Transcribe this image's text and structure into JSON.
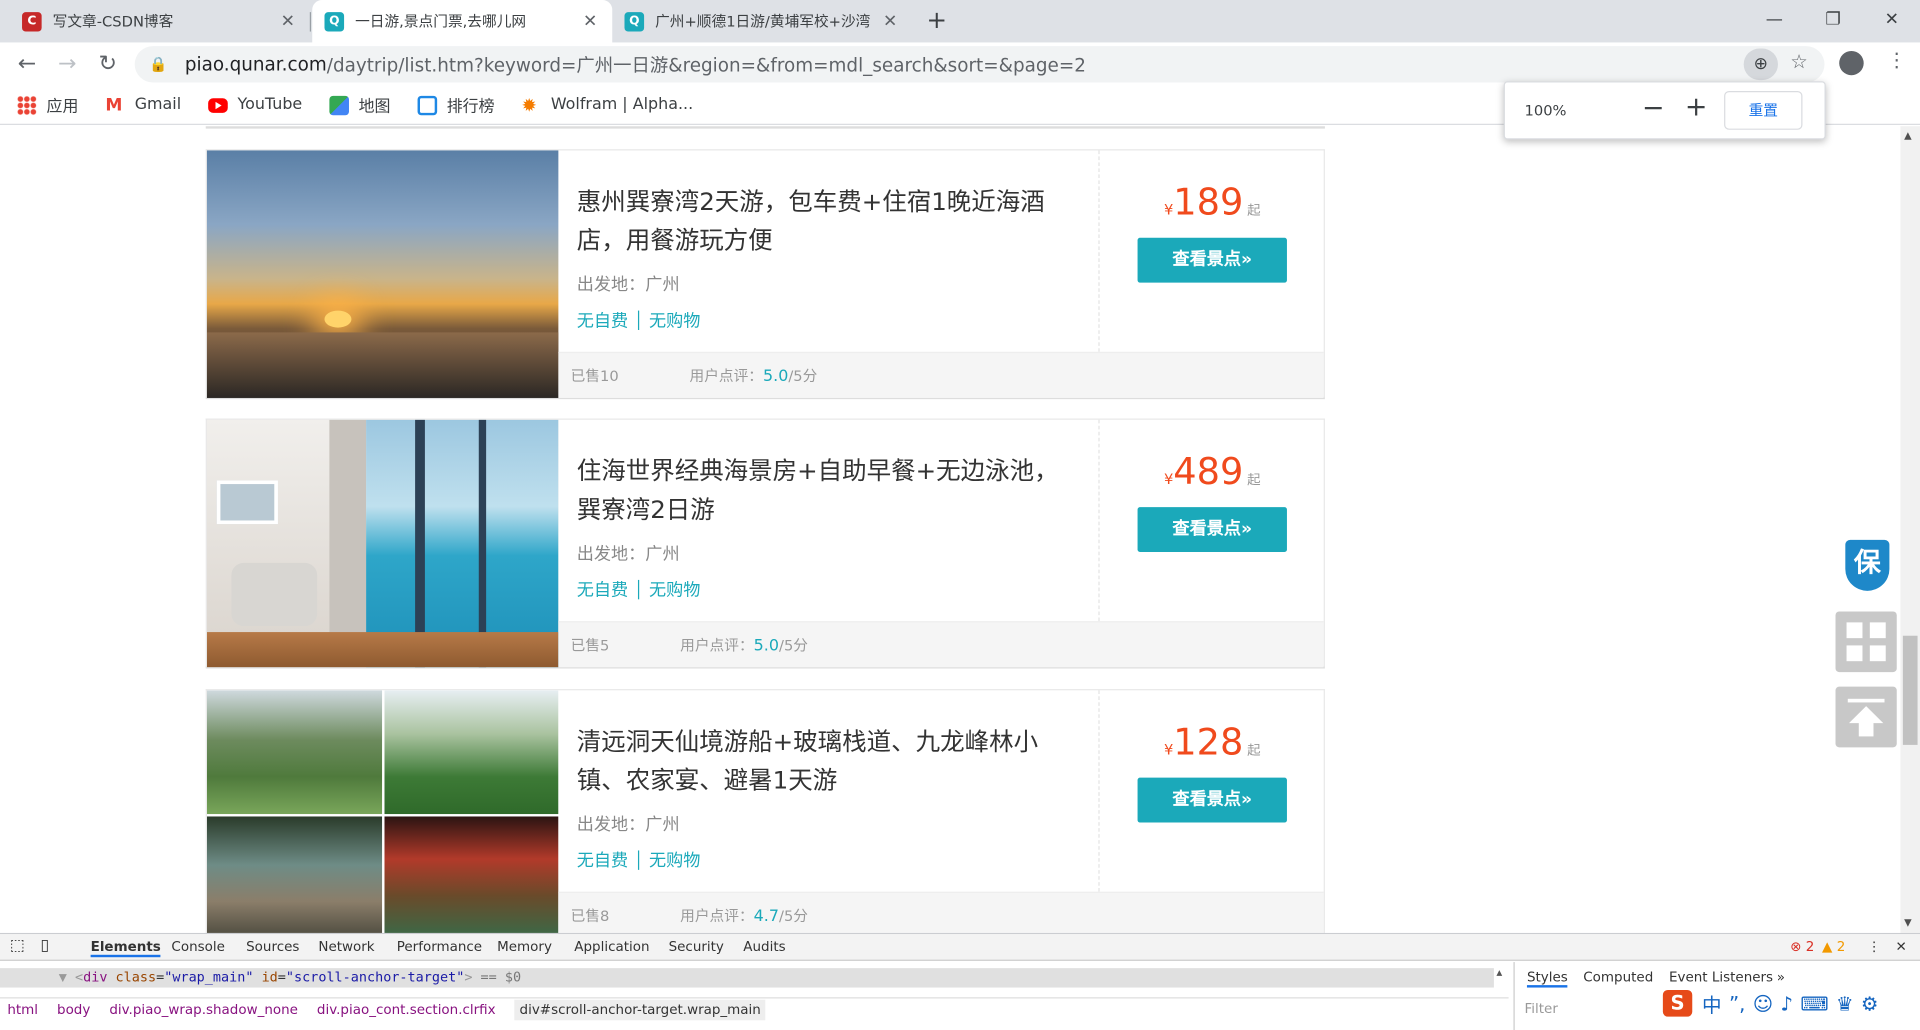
{
  "browser": {
    "tabs": [
      {
        "title": "写文章-CSDN博客",
        "icon": "csdn-icon",
        "active": false
      },
      {
        "title": "一日游,景点门票,去哪儿网",
        "icon": "qunar-icon",
        "active": true
      },
      {
        "title": "广州+顺德1日游/黄埔军校+沙湾",
        "icon": "qunar-icon",
        "active": false
      }
    ],
    "url": {
      "host": "piao.qunar.com",
      "path": "/daytrip/list.htm?keyword=广州一日游&region=&from=mdl_search&sort=&page=2"
    },
    "bookmarks": [
      {
        "label": "应用",
        "icon": "apps-icon"
      },
      {
        "label": "Gmail",
        "icon": "gmail-icon"
      },
      {
        "label": "YouTube",
        "icon": "youtube-icon"
      },
      {
        "label": "地图",
        "icon": "maps-icon"
      },
      {
        "label": "排行榜",
        "icon": "ranking-icon"
      },
      {
        "label": "Wolfram | Alpha...",
        "icon": "wolfram-icon"
      }
    ],
    "zoom": {
      "level": "100%",
      "minus": "−",
      "plus": "+",
      "reset": "重置"
    }
  },
  "products": [
    {
      "name": "惠州巽寮湾2天游，包车费+住宿1晚近海酒店，用餐游玩方便",
      "departure": "出发地：广州",
      "tags": [
        "无自费",
        "无购物"
      ],
      "currency": "¥",
      "price": "189",
      "price_suffix": "起",
      "button": "查看景点»",
      "sold": "已售10",
      "rating_label": "用户点评：",
      "rating": "5.0",
      "rating_suffix": "/5分"
    },
    {
      "name": "住海世界经典海景房+自助早餐+无边泳池，巽寮湾2日游",
      "departure": "出发地：广州",
      "tags": [
        "无自费",
        "无购物"
      ],
      "currency": "¥",
      "price": "489",
      "price_suffix": "起",
      "button": "查看景点»",
      "sold": "已售5",
      "rating_label": "用户点评：",
      "rating": "5.0",
      "rating_suffix": "/5分"
    },
    {
      "name": "清远洞天仙境游船+玻璃栈道、九龙峰林小镇、农家宴、避暑1天游",
      "departure": "出发地：广州",
      "tags": [
        "无自费",
        "无购物"
      ],
      "currency": "¥",
      "price": "128",
      "price_suffix": "起",
      "button": "查看景点»",
      "sold": "已售8",
      "rating_label": "用户点评：",
      "rating": "4.7",
      "rating_suffix": "/5分"
    }
  ],
  "side": {
    "guarantee": "保"
  },
  "devtools": {
    "tabs": [
      "Elements",
      "Console",
      "Sources",
      "Network",
      "Performance",
      "Memory",
      "Application",
      "Security",
      "Audits"
    ],
    "errors": "2",
    "warnings": "2",
    "selected_tag": "div",
    "selected_attrs": {
      "class_name": "class",
      "class_value": "\"wrap_main\"",
      "id_name": "id",
      "id_value": "\"scroll-anchor-target\"",
      "suffix": " == $0"
    },
    "breadcrumbs": [
      "html",
      "body",
      "div.piao_wrap.shadow_none",
      "div.piao_cont.section.clrfix",
      "div#scroll-anchor-target.wrap_main"
    ],
    "right_tabs": [
      "Styles",
      "Computed",
      "Event Listeners",
      "»"
    ],
    "filter_placeholder": "Filter"
  },
  "colors": {
    "accent": "#1ba9ba",
    "price": "#f04a1d"
  }
}
